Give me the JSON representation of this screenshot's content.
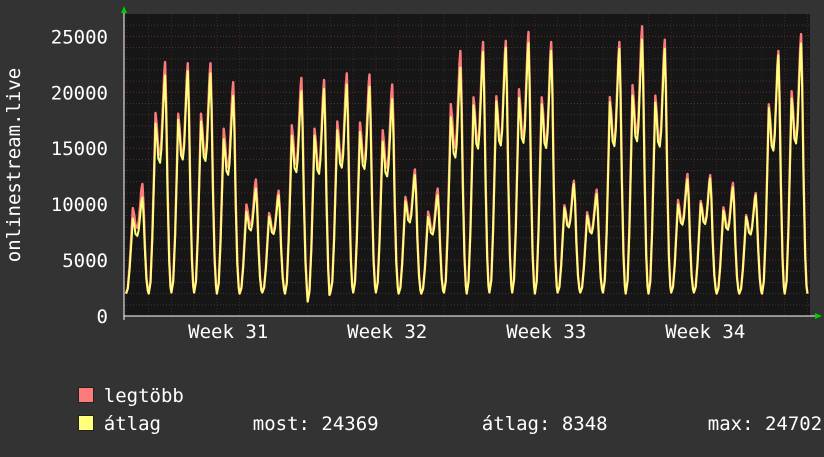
{
  "chart_data": {
    "type": "line",
    "ylabel": "onlinestream.live",
    "ylim": [
      0,
      27000
    ],
    "y_ticks": [
      0,
      5000,
      10000,
      15000,
      20000,
      25000
    ],
    "x_tick_labels": [
      "Week 31",
      "Week 32",
      "Week 33",
      "Week 34"
    ],
    "grid": true,
    "legend_placement": "bottom-left",
    "daily_min": [
      2000,
      2000,
      2100,
      2100,
      2000,
      2000,
      2100,
      2000,
      1300,
      2100,
      2100,
      2100,
      2000,
      2000,
      2100,
      2000,
      2100,
      2100,
      2000,
      2100,
      2100,
      2100,
      2000,
      2000,
      2100,
      2100,
      2000,
      2000,
      2000,
      2000,
      2000
    ],
    "series": [
      {
        "name": "legtöbb",
        "color": "#ff7b7b",
        "daily_peak": [
          11800,
          22700,
          22600,
          22600,
          20900,
          12200,
          11200,
          21300,
          21100,
          21700,
          21600,
          20700,
          13100,
          11400,
          23700,
          24500,
          24600,
          25400,
          24500,
          12100,
          11300,
          24500,
          25900,
          24700,
          12700,
          12600,
          11900,
          11000,
          23700,
          25200
        ]
      },
      {
        "name": "átlag",
        "color": "#ffff7b",
        "daily_peak": [
          10600,
          21500,
          21900,
          21700,
          19700,
          11400,
          10800,
          20100,
          20300,
          20700,
          20500,
          19400,
          12600,
          10800,
          22200,
          23600,
          24000,
          24400,
          23700,
          11800,
          10900,
          23900,
          24700,
          23900,
          12200,
          12300,
          11500,
          10800,
          23300,
          24369
        ]
      }
    ],
    "stats": {
      "most_label": "most:",
      "most_value": "24369",
      "atlag_label": "átlag:",
      "atlag_value": "8348",
      "max_label": "max:",
      "max_value": "24702"
    }
  }
}
